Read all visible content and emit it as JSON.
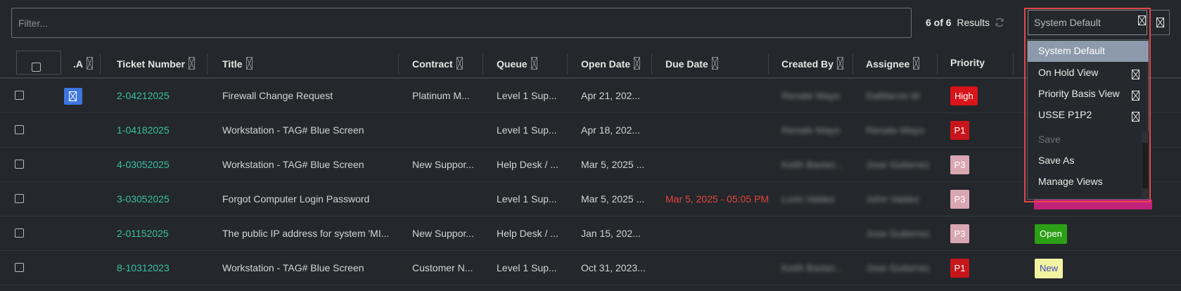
{
  "filter": {
    "placeholder": "Filter..."
  },
  "results": {
    "count": "6 of 6",
    "label": "Results"
  },
  "view_selector": {
    "selected": "System Default"
  },
  "columns": [
    {
      "id": "a",
      "label": ".A"
    },
    {
      "id": "ticket",
      "label": "Ticket Number"
    },
    {
      "id": "title",
      "label": "Title"
    },
    {
      "id": "contract",
      "label": "Contract"
    },
    {
      "id": "queue",
      "label": "Queue"
    },
    {
      "id": "open_date",
      "label": "Open Date"
    },
    {
      "id": "due_date",
      "label": "Due Date"
    },
    {
      "id": "created_by",
      "label": "Created By"
    },
    {
      "id": "assignee",
      "label": "Assignee"
    },
    {
      "id": "priority",
      "label": "Priority"
    }
  ],
  "rows": [
    {
      "ticket": "2-04212025",
      "title": "Firewall Change Request",
      "contract": "Platinum M...",
      "queue": "Level 1 Sup...",
      "open_date": "Apr 21, 202...",
      "due_date": "",
      "created_by": "Renate Mayo",
      "assignee": "DaMarcio W",
      "priority": "High",
      "status": ""
    },
    {
      "ticket": "1-04182025",
      "title": "Workstation - TAG# Blue Screen",
      "contract": "",
      "queue": "Level 1 Sup...",
      "open_date": "Apr 18, 202...",
      "due_date": "",
      "created_by": "Renate Mayo",
      "assignee": "Renate Mayo",
      "priority": "P1",
      "status": ""
    },
    {
      "ticket": "4-03052025",
      "title": "Workstation - TAG# Blue Screen",
      "contract": "New Suppor...",
      "queue": "Help Desk / ...",
      "open_date": "Mar 5, 2025 ...",
      "due_date": "",
      "created_by": "Keith Baxter...",
      "assignee": "Jose Gutierrez",
      "priority": "P3",
      "status": ""
    },
    {
      "ticket": "3-03052025",
      "title": "Forgot Computer Login Password",
      "contract": "",
      "queue": "Level 1 Sup...",
      "open_date": "Mar 5, 2025 ...",
      "due_date": "Mar 5, 2025 - 05:05 PM",
      "created_by": "Lorin Valdez",
      "assignee": "John Valdez",
      "priority": "P3",
      "status": ""
    },
    {
      "ticket": "2-01152025",
      "title": "The public IP address for system 'MI...",
      "contract": "New Suppor...",
      "queue": "Help Desk / ...",
      "open_date": "Jan 15, 202...",
      "due_date": "",
      "created_by": "",
      "assignee": "Jose Gutierrez",
      "priority": "P3",
      "status": "Open"
    },
    {
      "ticket": "8-10312023",
      "title": "Workstation - TAG# Blue Screen",
      "contract": "Customer N...",
      "queue": "Level 1 Sup...",
      "open_date": "Oct 31, 2023...",
      "due_date": "",
      "created_by": "Keith Baxter...",
      "assignee": "Jose Gutierrez",
      "priority": "P1",
      "status": "New"
    }
  ],
  "dropdown": {
    "items": [
      {
        "label": "System Default",
        "selected": true,
        "removable": false
      },
      {
        "label": "On Hold View",
        "selected": false,
        "removable": true
      },
      {
        "label": "Priority Basis View",
        "selected": false,
        "removable": true
      },
      {
        "label": "USSE P1P2",
        "selected": false,
        "removable": true
      }
    ],
    "actions": [
      {
        "label": "Save",
        "disabled": true
      },
      {
        "label": "Save As",
        "disabled": false
      },
      {
        "label": "Manage Views",
        "disabled": false
      }
    ]
  },
  "colors": {
    "accent_teal": "#39c0a3",
    "high": "#d8141a",
    "p1": "#c7161b",
    "p3": "#d8a7b1",
    "open": "#2c9f16",
    "new": "#f2f4a2",
    "highlight_frame": "#e0484d"
  }
}
